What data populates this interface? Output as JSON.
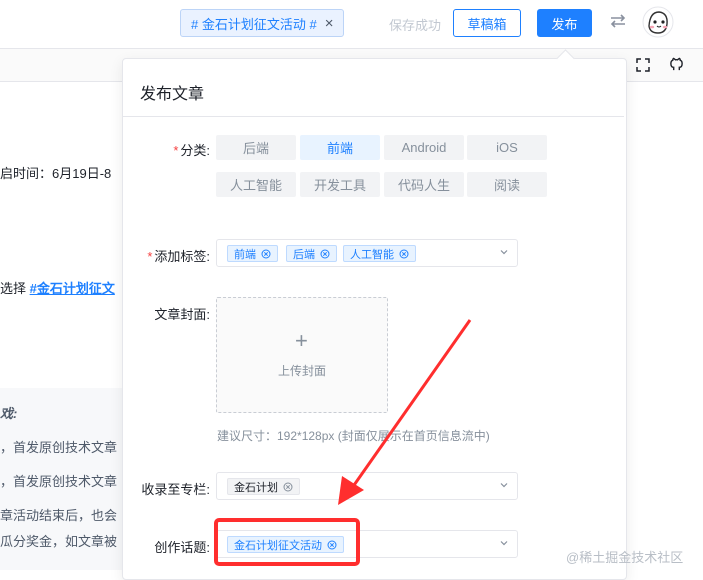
{
  "header": {
    "topic_chip": "# 金石计划征文活动 #",
    "topic_chip_close": "×",
    "save_status": "保存成功",
    "draft_button": "草稿箱",
    "publish_button": "发布"
  },
  "editor": {
    "line1": "启时间：6月19日-8",
    "line2_prefix": "选择 ",
    "line2_link": "#金石计划征文",
    "quote_title": "戏:",
    "quote_line1": "，首发原创技术文章",
    "quote_line2": "，首发原创技术文章",
    "quote_line3": "章活动结束后，也会",
    "quote_line4": "瓜分奖金，如文章被"
  },
  "panel": {
    "title": "发布文章",
    "category_label": "分类:",
    "categories": [
      "后端",
      "前端",
      "Android",
      "iOS",
      "人工智能",
      "开发工具",
      "代码人生",
      "阅读"
    ],
    "selected_category": "前端",
    "tags_label": "添加标签:",
    "tags": [
      "前端",
      "后端",
      "人工智能"
    ],
    "cover_label": "文章封面:",
    "upload_plus": "+",
    "upload_text": "上传封面",
    "cover_hint": "建议尺寸：192*128px (封面仅展示在首页信息流中)",
    "column_label": "收录至专栏:",
    "column_tag": "金石计划",
    "topic_label": "创作话题:",
    "topic_tag": "金石计划征文活动"
  },
  "annotation": {
    "color": "#ff2e2e"
  },
  "watermark": "@稀土掘金技术社区",
  "colors": {
    "accent": "#1e80ff",
    "required": "#f53f3f"
  }
}
